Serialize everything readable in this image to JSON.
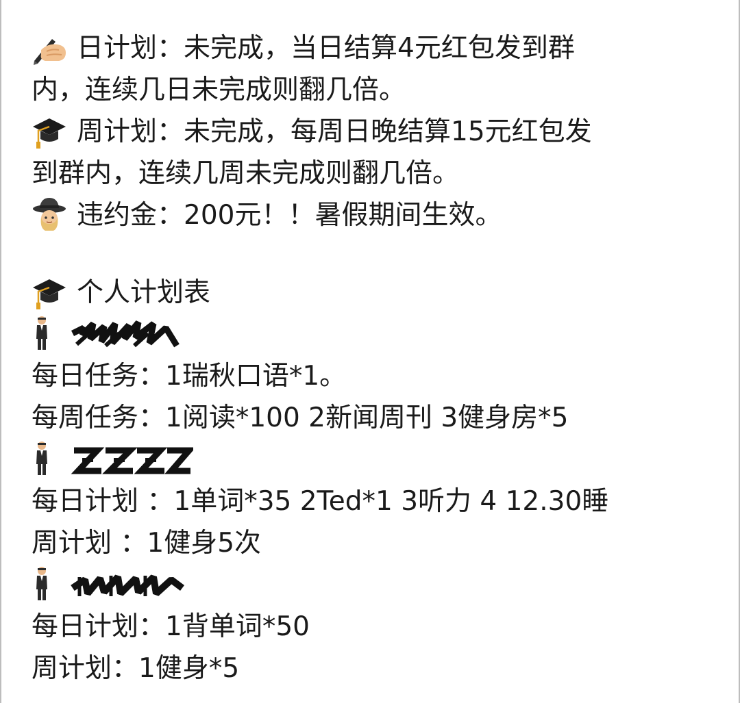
{
  "message": {
    "rules": {
      "daily_rule": "日计划：未完成，当日结算4元红包发到群内，连续几日未完成则翻几倍。",
      "daily_rule_line1": "日计划：未完成，当日结算4元红包发到群",
      "daily_rule_line2": "内，连续几日未完成则翻几倍。",
      "daily_rule_icon": "writing-hand-icon",
      "weekly_rule_line1": "周计划：未完成，每周日晚结算15元红包发",
      "weekly_rule_line2": "到群内，连续几周未完成则翻几倍。",
      "weekly_rule_icon": "graduation-cap-icon",
      "penalty_rule": "违约金：200元！！暑假期间生效。",
      "penalty_rule_icon": "detective-icon"
    },
    "plan_section": {
      "heading": "个人计划表",
      "heading_icon": "graduation-cap-icon"
    },
    "members": [
      {
        "icon": "standing-man-icon",
        "name_redacted": true,
        "task_lines": [
          "每日任务：1瑞秋口语*1。",
          "每周任务：1阅读*100 2新闻周刊 3健身房*5"
        ]
      },
      {
        "icon": "standing-man-icon",
        "name_redacted": true,
        "task_lines": [
          "每日计划 ：1单词*35 2Ted*1 3听力 4 12.30睡",
          "周计划 ：1健身5次"
        ]
      },
      {
        "icon": "standing-man-icon",
        "name_redacted": true,
        "task_lines": [
          "每日计划：1背单词*50",
          "周计划：1健身*5"
        ]
      }
    ]
  },
  "colors": {
    "background": "#ffffff",
    "text": "#1a1a1a",
    "side_border": "#bdbdbd"
  }
}
